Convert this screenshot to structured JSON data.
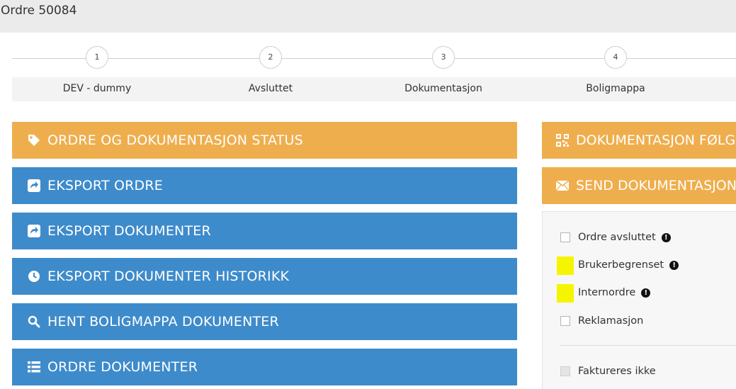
{
  "header": {
    "title": "Ordre 50084"
  },
  "stepper": {
    "steps": [
      {
        "number": "1",
        "label": "DEV - dummy"
      },
      {
        "number": "2",
        "label": "Avsluttet"
      },
      {
        "number": "3",
        "label": "Dokumentasjon"
      },
      {
        "number": "4",
        "label": "Boligmappa"
      }
    ]
  },
  "left_buttons": [
    {
      "label": "ORDRE OG DOKUMENTASJON STATUS",
      "icon": "tag-icon",
      "color": "#efae4d"
    },
    {
      "label": "EKSPORT ORDRE",
      "icon": "share-icon",
      "color": "#3e8bcb"
    },
    {
      "label": "EKSPORT DOKUMENTER",
      "icon": "share-icon",
      "color": "#3e8bcb"
    },
    {
      "label": "EKSPORT DOKUMENTER HISTORIKK",
      "icon": "clock-icon",
      "color": "#3e8bcb"
    },
    {
      "label": "HENT BOLIGMAPPA DOKUMENTER",
      "icon": "search-icon",
      "color": "#3e8bcb"
    },
    {
      "label": "ORDRE DOKUMENTER",
      "icon": "list-icon",
      "color": "#3e8bcb"
    }
  ],
  "right_buttons": [
    {
      "label": "DOKUMENTASJON FØLG",
      "icon": "qrcode-icon"
    },
    {
      "label": "SEND DOKUMENTASJON",
      "icon": "envelope-icon"
    }
  ],
  "options": [
    {
      "label": "Ordre avsluttet",
      "checked": false,
      "info": true
    },
    {
      "label": "Brukerbegrenset",
      "checked": true,
      "info": true,
      "highlight": true
    },
    {
      "label": "Internordre",
      "checked": true,
      "info": true,
      "highlight": true
    },
    {
      "label": "Reklamasjon",
      "checked": false,
      "info": false
    },
    {
      "label": "Faktureres ikke",
      "checked": false,
      "disabled": true
    }
  ],
  "colors": {
    "orange": "#efae4d",
    "blue": "#3e8bcb",
    "highlight": "#f5f500"
  }
}
